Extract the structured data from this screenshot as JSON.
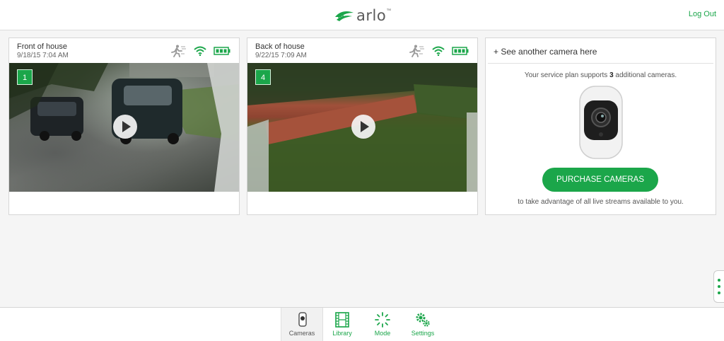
{
  "header": {
    "logo_text": "arlo",
    "logo_tm": "™",
    "logout_label": "Log Out"
  },
  "cameras": [
    {
      "name": "Front of house",
      "date": "9/18/15 7:04 AM",
      "badge": "1"
    },
    {
      "name": "Back of house",
      "date": "9/22/15 7:09 AM",
      "badge": "4"
    }
  ],
  "add_camera": {
    "title": "+ See another camera here",
    "plan_prefix": "Your service plan supports ",
    "plan_count": "3",
    "plan_suffix": " additional cameras.",
    "purchase_label": "PURCHASE CAMERAS",
    "advantage_text": "to take advantage of all live streams available to you."
  },
  "bottom_nav": [
    {
      "label": "Cameras",
      "icon": "camera-icon",
      "active": true
    },
    {
      "label": "Library",
      "icon": "film-icon",
      "active": false
    },
    {
      "label": "Mode",
      "icon": "spinner-icon",
      "active": false
    },
    {
      "label": "Settings",
      "icon": "gears-icon",
      "active": false
    }
  ],
  "colors": {
    "accent": "#1ba64a",
    "background": "#f5f5f5"
  }
}
